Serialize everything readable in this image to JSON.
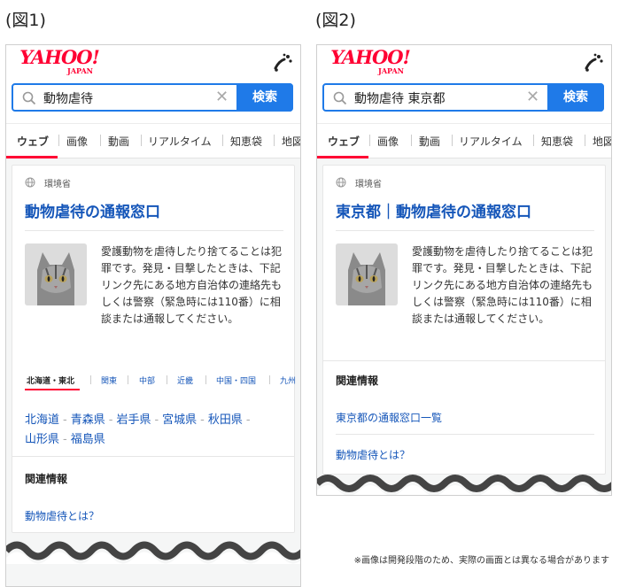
{
  "figure1": {
    "label": "(図1)",
    "logo_main": "YAHOO!",
    "logo_sub": "JAPAN",
    "search_value": "動物虐待",
    "search_button": "検索",
    "tabs": [
      "ウェブ",
      "画像",
      "動画",
      "リアルタイム",
      "知恵袋",
      "地図"
    ],
    "result": {
      "source": "環境省",
      "title": "動物虐待の通報窓口",
      "desc": "愛護動物を虐待したり捨てることは犯罪です。発見・目撃したときは、下記リンク先にある地方自治体の連絡先もしくは警察（緊急時には110番）に相談または通報してください。",
      "region_tabs": [
        "北海道・東北",
        "関東",
        "中部",
        "近畿",
        "中国・四国",
        "九州"
      ],
      "prefectures_line1": [
        "北海道",
        "青森県",
        "岩手県",
        "宮城県",
        "秋田県"
      ],
      "prefectures_line2": [
        "山形県",
        "福島県"
      ],
      "related_title": "関連情報",
      "related_links": [
        "動物虐待とは？"
      ]
    }
  },
  "figure2": {
    "label": "(図2)",
    "logo_main": "YAHOO!",
    "logo_sub": "JAPAN",
    "search_value": "動物虐待 東京都",
    "search_button": "検索",
    "tabs": [
      "ウェブ",
      "画像",
      "動画",
      "リアルタイム",
      "知恵袋",
      "地図"
    ],
    "result": {
      "source": "環境省",
      "title": "東京都｜動物虐待の通報窓口",
      "desc": "愛護動物を虐待したり捨てることは犯罪です。発見・目撃したときは、下記リンク先にある地方自治体の連絡先もしくは警察（緊急時には110番）に相談または通報してください。",
      "related_title": "関連情報",
      "related_links": [
        "東京都の通報窓口一覧",
        "動物虐待とは？"
      ]
    }
  },
  "footnote": "※画像は開発段階のため、実際の画面とは異なる場合があります",
  "colors": {
    "accent_blue": "#1f7ae8",
    "link_blue": "#1556b9",
    "brand_red": "#ff0033"
  }
}
